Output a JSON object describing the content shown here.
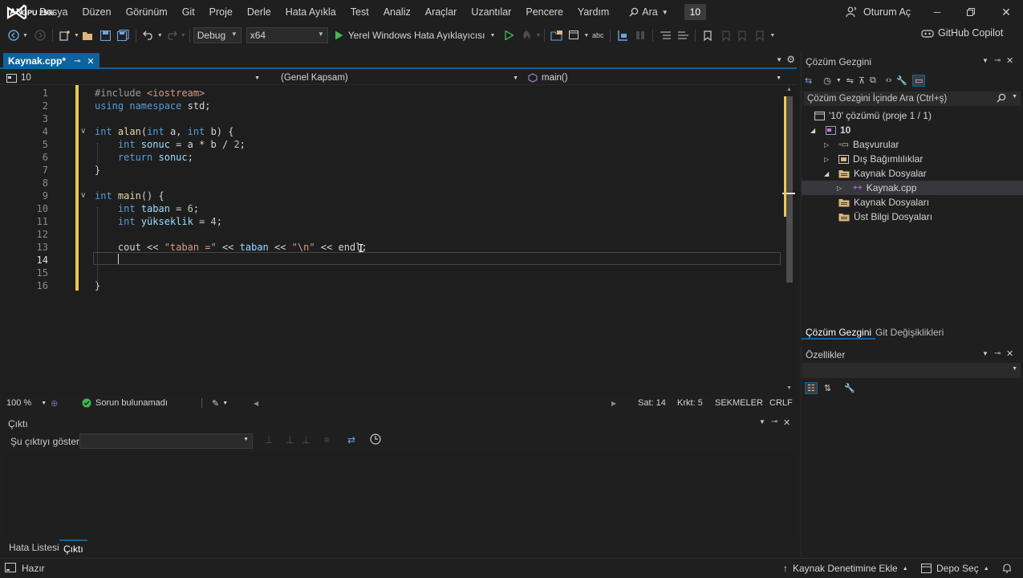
{
  "app": {
    "logo_text": "AN",
    "gpu_badge": "GPU 25%"
  },
  "menu": [
    "Dosya",
    "Düzen",
    "Görünüm",
    "Git",
    "Proje",
    "Derle",
    "Hata Ayıkla",
    "Test",
    "Analiz",
    "Araçlar",
    "Uzantılar",
    "Pencere",
    "Yardım"
  ],
  "search": {
    "label": "Ara"
  },
  "solution_badge": "10",
  "account": {
    "sign_in": "Oturum Aç"
  },
  "toolbar": {
    "configuration": "Debug",
    "platform": "x64",
    "run_target": "Yerel Windows Hata Ayıklayıcısı",
    "copilot": "GitHub Copilot"
  },
  "editor": {
    "tab_title": "Kaynak.cpp*",
    "nav_project": "10",
    "nav_scope": "(Genel Kapsam)",
    "nav_member": "main()",
    "active_line": 14,
    "lines": [
      {
        "n": "1",
        "tokens": [
          {
            "c": "pp",
            "t": "#include "
          },
          {
            "c": "inc",
            "t": "<iostream>"
          }
        ]
      },
      {
        "n": "2",
        "tokens": [
          {
            "c": "kw",
            "t": "using"
          },
          {
            "c": "",
            "t": " "
          },
          {
            "c": "kw",
            "t": "namespace"
          },
          {
            "c": "",
            "t": " std;"
          }
        ]
      },
      {
        "n": "3",
        "tokens": []
      },
      {
        "n": "4",
        "tokens": [
          {
            "c": "kw",
            "t": "int"
          },
          {
            "c": "",
            "t": " "
          },
          {
            "c": "fn",
            "t": "alan"
          },
          {
            "c": "",
            "t": "("
          },
          {
            "c": "kw",
            "t": "int"
          },
          {
            "c": "",
            "t": " a, "
          },
          {
            "c": "kw",
            "t": "int"
          },
          {
            "c": "",
            "t": " b) {"
          }
        ]
      },
      {
        "n": "5",
        "tokens": [
          {
            "c": "",
            "t": "    "
          },
          {
            "c": "kw",
            "t": "int"
          },
          {
            "c": "",
            "t": " "
          },
          {
            "c": "id",
            "t": "sonuc"
          },
          {
            "c": "",
            "t": " = a * b / "
          },
          {
            "c": "num",
            "t": "2"
          },
          {
            "c": "",
            "t": ";"
          }
        ]
      },
      {
        "n": "6",
        "tokens": [
          {
            "c": "",
            "t": "    "
          },
          {
            "c": "kw",
            "t": "return"
          },
          {
            "c": "",
            "t": " "
          },
          {
            "c": "id",
            "t": "sonuc"
          },
          {
            "c": "",
            "t": ";"
          }
        ]
      },
      {
        "n": "7",
        "tokens": [
          {
            "c": "",
            "t": "}"
          }
        ]
      },
      {
        "n": "8",
        "tokens": []
      },
      {
        "n": "9",
        "tokens": [
          {
            "c": "kw",
            "t": "int"
          },
          {
            "c": "",
            "t": " "
          },
          {
            "c": "fn",
            "t": "main"
          },
          {
            "c": "",
            "t": "() {"
          }
        ]
      },
      {
        "n": "10",
        "tokens": [
          {
            "c": "",
            "t": "    "
          },
          {
            "c": "kw",
            "t": "int"
          },
          {
            "c": "",
            "t": " "
          },
          {
            "c": "id",
            "t": "taban"
          },
          {
            "c": "",
            "t": " = "
          },
          {
            "c": "num",
            "t": "6"
          },
          {
            "c": "",
            "t": ";"
          }
        ]
      },
      {
        "n": "11",
        "tokens": [
          {
            "c": "",
            "t": "    "
          },
          {
            "c": "kw",
            "t": "int"
          },
          {
            "c": "",
            "t": " "
          },
          {
            "c": "id",
            "t": "yükseklik"
          },
          {
            "c": "",
            "t": " = "
          },
          {
            "c": "num",
            "t": "4"
          },
          {
            "c": "",
            "t": ";"
          }
        ]
      },
      {
        "n": "12",
        "tokens": []
      },
      {
        "n": "13",
        "tokens": [
          {
            "c": "",
            "t": "    cout << "
          },
          {
            "c": "str",
            "t": "\"taban =\""
          },
          {
            "c": "",
            "t": " << "
          },
          {
            "c": "id",
            "t": "taban"
          },
          {
            "c": "",
            "t": " << "
          },
          {
            "c": "str",
            "t": "\"\\n\""
          },
          {
            "c": "",
            "t": " << endl;"
          }
        ]
      },
      {
        "n": "14",
        "tokens": []
      },
      {
        "n": "15",
        "tokens": []
      },
      {
        "n": "16",
        "tokens": [
          {
            "c": "",
            "t": "}"
          }
        ]
      }
    ]
  },
  "editor_status": {
    "zoom": "100 %",
    "issues": "Sorun bulunamadı",
    "line": "Sat: 14",
    "col": "Krkt: 5",
    "indent": "SEKMELER",
    "eol": "CRLF"
  },
  "output": {
    "title": "Çıktı",
    "show_label": "Şu çıktıyı göster:",
    "source_value": ""
  },
  "bottom_tabs": [
    "Hata Listesi",
    "Çıktı"
  ],
  "solution_explorer": {
    "title": "Çözüm Gezgini",
    "search_placeholder": "Çözüm Gezgini İçinde Ara (Ctrl+ş)",
    "solution": "'10' çözümü (proje 1 / 1)",
    "project": "10",
    "references": "Başvurular",
    "external_deps": "Dış Bağımlılıklar",
    "source_files": "Kaynak Dosyalar",
    "source_file": "Kaynak.cpp",
    "resource_files": "Kaynak Dosyaları",
    "header_files": "Üst Bilgi Dosyaları",
    "tab_solution": "Çözüm Gezgini",
    "tab_git": "Git Değişiklikleri"
  },
  "properties": {
    "title": "Özellikler"
  },
  "statusbar": {
    "ready": "Hazır",
    "add_source_control": "Kaynak Denetimine Ekle",
    "select_repo": "Depo Seç"
  },
  "colors": {
    "accent": "#0e639c",
    "keyword": "#569cd6",
    "identifier": "#9cdcfe",
    "function": "#dcdcaa",
    "string": "#d69d85",
    "number": "#b5cea8",
    "success": "#3fb950",
    "run_green": "#3fb950"
  }
}
